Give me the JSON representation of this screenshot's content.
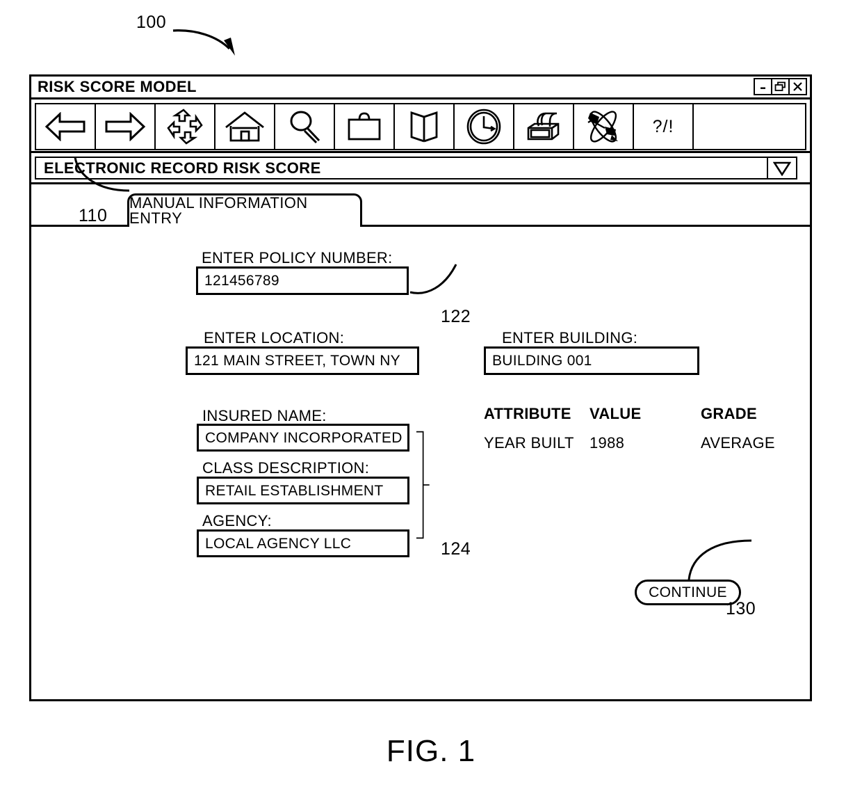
{
  "figure": {
    "caption": "FIG. 1",
    "callouts": [
      {
        "id": "100",
        "label": "100"
      },
      {
        "id": "110",
        "label": "110"
      },
      {
        "id": "122",
        "label": "122"
      },
      {
        "id": "124",
        "label": "124"
      },
      {
        "id": "130",
        "label": "130"
      }
    ]
  },
  "window": {
    "title": "RISK SCORE MODEL",
    "controls": [
      {
        "name": "minimize-button",
        "icon": "minimize-icon",
        "label": "-"
      },
      {
        "name": "restore-button",
        "icon": "restore-icon",
        "label": ""
      },
      {
        "name": "close-button",
        "icon": "close-icon",
        "label": "X"
      }
    ]
  },
  "toolbar": {
    "buttons": [
      {
        "name": "back-button",
        "icon": "left-arrow-icon"
      },
      {
        "name": "forward-button",
        "icon": "right-arrow-icon"
      },
      {
        "name": "refresh-button",
        "icon": "cyclic-arrows-icon"
      },
      {
        "name": "home-button",
        "icon": "home-icon"
      },
      {
        "name": "search-button",
        "icon": "magnifier-icon"
      },
      {
        "name": "briefcase-button",
        "icon": "briefcase-icon"
      },
      {
        "name": "book-button",
        "icon": "open-book-icon"
      },
      {
        "name": "history-button",
        "icon": "clock-icon"
      },
      {
        "name": "print-button",
        "icon": "printer-icon"
      },
      {
        "name": "airplane-button",
        "icon": "airplane-icon"
      },
      {
        "name": "help-button",
        "icon": "help-icon",
        "label": "?/!"
      }
    ]
  },
  "section": {
    "title": "ELECTRONIC RECORD RISK SCORE",
    "dropdown_icon": "triangle-down-icon"
  },
  "tabs": [
    {
      "name": "tab-manual-information-entry",
      "label": "MANUAL INFORMATION ENTRY",
      "active": true
    }
  ],
  "form": {
    "policy_number": {
      "label": "ENTER POLICY NUMBER:",
      "value": "121456789",
      "placeholder": "ENTER POLICY NUMBER"
    },
    "location": {
      "label": "ENTER LOCATION:",
      "value": "121 MAIN STREET, TOWN  NY",
      "placeholder": "ENTER LOCATION"
    },
    "building": {
      "label": "ENTER BUILDING:",
      "value": "BUILDING 001",
      "placeholder": "ENTER BUILDING"
    },
    "insured_name": {
      "label": "INSURED NAME:",
      "value": "COMPANY INCORPORATED",
      "placeholder": "INSURED NAME"
    },
    "class_description": {
      "label": "CLASS DESCRIPTION:",
      "value": "RETAIL ESTABLISHMENT",
      "placeholder": "CLASS DESCRIPTION"
    },
    "agency": {
      "label": "AGENCY:",
      "value": "LOCAL AGENCY LLC",
      "placeholder": "AGENCY"
    }
  },
  "attribute_table": {
    "headers": [
      "ATTRIBUTE",
      "VALUE",
      "GRADE"
    ],
    "rows": [
      {
        "attribute": "YEAR BUILT",
        "value": "1988",
        "grade": "AVERAGE"
      }
    ]
  },
  "actions": {
    "continue_label": "CONTINUE"
  },
  "colors": {
    "line": "#000000",
    "background": "#ffffff"
  }
}
